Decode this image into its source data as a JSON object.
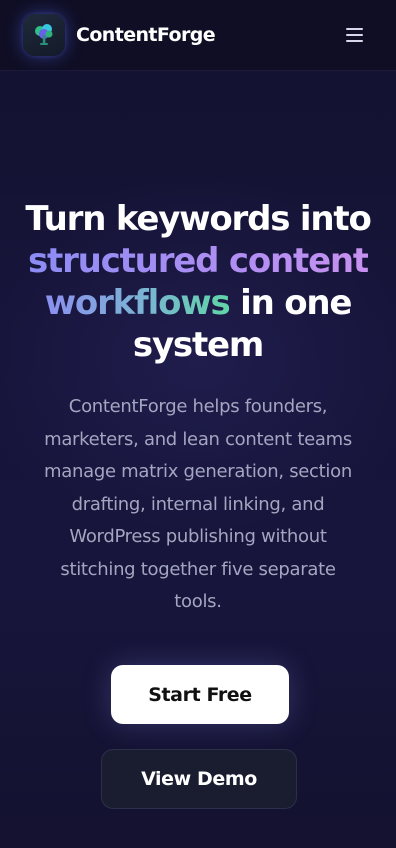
{
  "header": {
    "brand": "ContentForge",
    "logo_icon": "tree-icon",
    "menu_icon": "hamburger-menu-icon"
  },
  "hero": {
    "headline_line1": "Turn keywords into",
    "headline_line2": "structured content",
    "headline_line3_highlight": "workflows",
    "headline_line3_rest": " in one",
    "headline_line4": "system",
    "description_lines": [
      "ContentForge helps founders,",
      "marketers, and lean content teams",
      "manage matrix generation, section",
      "drafting, internal linking, and",
      "WordPress publishing without",
      "stitching together five separate",
      "tools."
    ]
  },
  "actions": {
    "primary_label": "Start Free",
    "secondary_label": "View Demo"
  },
  "colors": {
    "background": "#14122f",
    "topbar": "#0f0e24",
    "gradient_purple_start": "#8b8cf4",
    "gradient_purple_end": "#c791f0",
    "gradient_green_end": "#5fd6a6",
    "body_text": "#a3a6c0",
    "primary_button": "#ffffff",
    "secondary_button": "#1a1d30"
  }
}
